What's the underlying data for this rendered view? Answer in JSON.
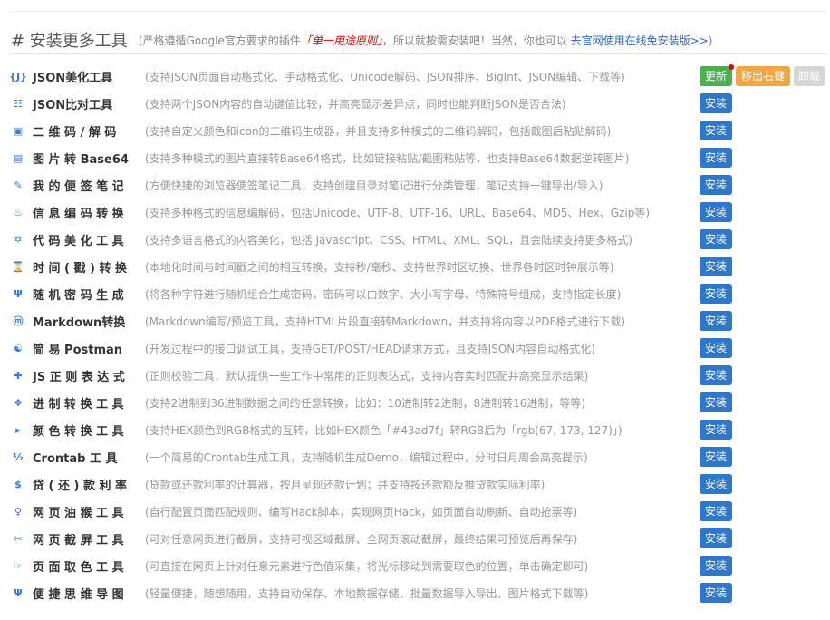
{
  "header": {
    "title": "# 安装更多工具",
    "desc_prefix": "(严格遵循Google官方要求的插件",
    "desc_red": "「单一用途原则」",
    "desc_middle": "，所以就按需安装吧！当然，你也可以",
    "desc_link": "去官网使用在线免安装版>>",
    "desc_suffix": ")"
  },
  "buttons": {
    "install": "安装",
    "update": "更新",
    "remove_right_key": "移出右键",
    "uninstall": "卸载"
  },
  "tools": [
    {
      "icon": "json-icon",
      "glyph": "{J}",
      "name": "JSON美化工具",
      "desc": "(支持JSON页面自动格式化、手动格式化、Unicode解码、JSON排序、BigInt、JSON编辑、下载等)",
      "installed": true
    },
    {
      "icon": "compare-icon",
      "glyph": "☷",
      "name": "JSON比对工具",
      "desc": "(支持两个JSON内容的自动键值比较，并高亮显示差异点，同时也能判断JSON是否合法)"
    },
    {
      "icon": "qrcode-icon",
      "glyph": "▣",
      "name": "二 维 码 / 解 码",
      "desc": "(支持自定义颜色和icon的二维码生成器，并且支持多种模式的二维码解码，包括截图后粘贴解码)"
    },
    {
      "icon": "image-base64-icon",
      "glyph": "▤",
      "name": "图 片 转 Base64",
      "desc": "(支持多种模式的图片直接转Base64格式，比如链接粘贴/截图粘贴等，也支持Base64数据逆转图片)"
    },
    {
      "icon": "pencil-icon",
      "glyph": "✎",
      "name": "我 的 便 签 笔 记",
      "desc": "(方便快捷的浏览器便签笔记工具，支持创建目录对笔记进行分类管理，笔记支持一键导出/导入)"
    },
    {
      "icon": "encode-icon",
      "glyph": "♨",
      "name": "信 息 编 码 转 换",
      "desc": "(支持多种格式的信息编解码，包括Unicode、UTF-8、UTF-16、URL、Base64、MD5、Hex、Gzip等)"
    },
    {
      "icon": "code-beautify-icon",
      "glyph": "✡",
      "name": "代 码 美 化 工 具",
      "desc": "(支持多语言格式的内容美化，包括 Javascript、CSS、HTML、XML、SQL，且会陆续支持更多格式)"
    },
    {
      "icon": "hourglass-icon",
      "glyph": "⌛",
      "name": "时 间 ( 戳 ) 转 换",
      "desc": "(本地化时间与时间戳之间的相互转换，支持秒/毫秒、支持世界时区切换、世界各时区时钟展示等)"
    },
    {
      "icon": "password-icon",
      "glyph": "Ψ",
      "name": "随 机 密 码 生 成",
      "desc": "(将各种字符进行随机组合生成密码，密码可以由数字、大小写字母、特殊符号组成，支持指定长度)"
    },
    {
      "icon": "markdown-icon",
      "glyph": "ⓜ",
      "name": "Markdown转换",
      "desc": "(Markdown编写/预览工具，支持HTML片段直接转Markdown，并支持将内容以PDF格式进行下载)"
    },
    {
      "icon": "postman-icon",
      "glyph": "☯",
      "name": "简 易 Postman",
      "desc": "(开发过程中的接口调试工具，支持GET/POST/HEAD请求方式，且支持JSON内容自动格式化)"
    },
    {
      "icon": "regex-icon",
      "glyph": "✚",
      "name": "JS 正 则 表 达 式",
      "desc": "(正则校验工具，默认提供一些工作中常用的正则表达式，支持内容实时匹配并高亮显示结果)"
    },
    {
      "icon": "radix-icon",
      "glyph": "❖",
      "name": "进 制 转 换 工 具",
      "desc": "(支持2进制到36进制数据之间的任意转换，比如：10进制转2进制，8进制转16进制，等等)"
    },
    {
      "icon": "color-convert-icon",
      "glyph": "▸",
      "name": "颜 色 转 换 工 具",
      "desc": "(支持HEX颜色到RGB格式的互转，比如HEX颜色「#43ad7f」转RGB后为「rgb(67, 173, 127)」)"
    },
    {
      "icon": "crontab-icon",
      "glyph": "½",
      "name": "Crontab 工 具",
      "desc": "(一个简易的Crontab生成工具，支持随机生成Demo，编辑过程中，分时日月周会高亮提示)"
    },
    {
      "icon": "dollar-icon",
      "glyph": "$",
      "name": "贷 ( 还 ) 款 利 率",
      "desc": "(贷款或还款利率的计算器，按月呈现还款计划；并支持按还款额反推贷款实际利率)"
    },
    {
      "icon": "monkey-icon",
      "glyph": "♀",
      "name": "网 页 油 猴 工 具",
      "desc": "(自行配置页面匹配规则、编写Hack脚本，实现网页Hack，如页面自动刷新、自动抢票等)"
    },
    {
      "icon": "scissors-icon",
      "glyph": "✂",
      "name": "网 页 截 屏 工 具",
      "desc": "(可对任意网页进行截屏，支持可视区域截屏、全网页滚动截屏，最终结果可预览后再保存)"
    },
    {
      "icon": "color-picker-icon",
      "glyph": "☞",
      "name": "页 面 取 色 工 具",
      "desc": "(可直接在网页上针对任意元素进行色值采集，将光标移动到需要取色的位置，单击确定即可)"
    },
    {
      "icon": "mindmap-icon",
      "glyph": "Ψ",
      "name": "便 捷 思 维 导 图",
      "desc": "(轻量便捷，随想随用，支持自动保存、本地数据存储、批量数据导入导出、图片格式下载等)"
    }
  ],
  "colors": {
    "install": "#3077c9",
    "update": "#4caf50",
    "remove": "#f5a640",
    "uninstall": "#d6d6d6",
    "accent_red": "#e00000",
    "link": "#2d68c4"
  }
}
